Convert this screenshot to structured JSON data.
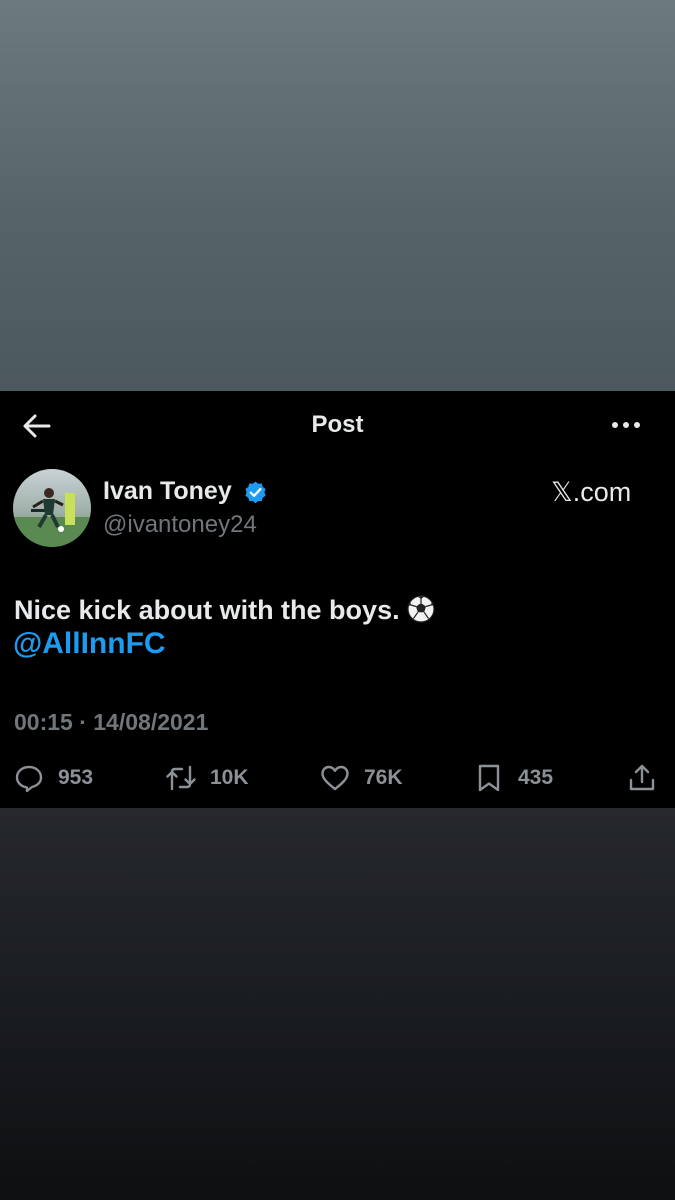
{
  "header": {
    "title": "Post"
  },
  "tweet": {
    "author_name": "Ivan Toney",
    "handle": "@ivantoney24",
    "source": "𝕏.com",
    "text": "Nice kick about with the boys.",
    "emoji_icon": "soccer-ball-icon",
    "mention": "@AllInnFC",
    "timestamp": "00:15 · 14/08/2021",
    "verified_color": "#1d9bf0",
    "mention_color": "#1d9bf0"
  },
  "actions": {
    "replies": "953",
    "reposts": "10K",
    "likes": "76K",
    "bookmarks": "435"
  }
}
